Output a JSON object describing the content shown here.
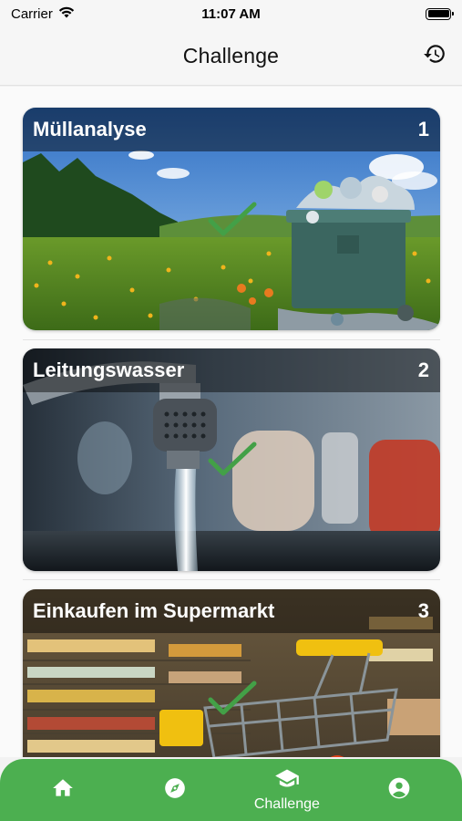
{
  "status": {
    "carrier": "Carrier",
    "time": "11:07 AM"
  },
  "nav": {
    "title": "Challenge",
    "history_icon": "history-icon"
  },
  "cards": [
    {
      "title": "Müllanalyse",
      "number": "1",
      "completed": true
    },
    {
      "title": "Leitungswasser",
      "number": "2",
      "completed": true
    },
    {
      "title": "Einkaufen im Supermarkt",
      "number": "3",
      "completed": true
    }
  ],
  "tabbar": {
    "accent": "#4caf50",
    "active_label": "Challenge",
    "items": [
      "home-icon",
      "compass-icon",
      "school-icon",
      "account-icon"
    ]
  }
}
